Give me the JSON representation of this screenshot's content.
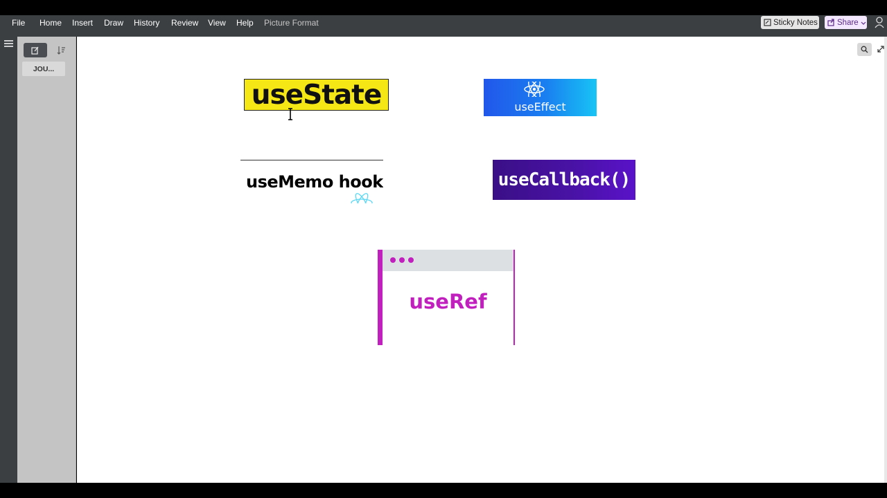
{
  "ribbon": {
    "tabs": [
      "File",
      "Home",
      "Insert",
      "Draw",
      "History",
      "Review",
      "View",
      "Help"
    ],
    "context_tab": "Picture Format",
    "sticky_notes_label": "Sticky Notes",
    "share_label": "Share"
  },
  "sidebar": {
    "page_item_label": "JOU..."
  },
  "canvas": {
    "images": [
      {
        "id": "usestate",
        "text": "useState",
        "bg": "#f5e716"
      },
      {
        "id": "useeffect",
        "text": "useEffect",
        "bg": "#1a7ff0"
      },
      {
        "id": "usememo",
        "text": "useMemo hook",
        "bg": "#ffffff"
      },
      {
        "id": "usecallback",
        "text": "useCallback()",
        "bg": "#4a12a8"
      },
      {
        "id": "useref",
        "text": "useRef",
        "accent": "#c21fbf"
      }
    ]
  },
  "icons": {
    "hamburger": "hamburger-icon",
    "new_page": "new-page-icon",
    "sort": "sort-icon",
    "search": "search-icon",
    "expand": "expand-icon",
    "person": "person-icon",
    "sticky": "sticky-note-icon",
    "chevron": "chevron-down-icon",
    "react_atom": "react-atom-icon",
    "text_cursor": "text-cursor-icon"
  }
}
